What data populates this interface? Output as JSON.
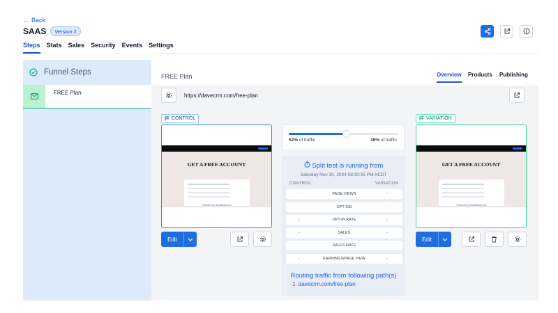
{
  "header": {
    "back_label": "Back",
    "title": "SAAS",
    "version": "Version 2",
    "tabs": [
      "Steps",
      "Stats",
      "Sales",
      "Security",
      "Events",
      "Settings"
    ],
    "icons": [
      "share-icon",
      "external-link-icon",
      "info-icon"
    ]
  },
  "sidebar": {
    "title": "Funnel Steps",
    "items": [
      {
        "label": "FREE Plan"
      }
    ]
  },
  "main": {
    "plan_name": "FREE Plan",
    "tabs": [
      "Overview",
      "Products",
      "Publishing"
    ],
    "url": "https://davecrm.com/free-plan"
  },
  "control": {
    "tag": "CONTROL",
    "preview_heading": "GET A FREE ACCOUNT",
    "preview_footer": "Powered by SmallBusiness",
    "edit_label": "Edit"
  },
  "variation": {
    "tag": "VARIATION",
    "preview_heading": "GET A FREE ACCOUNT",
    "preview_footer": "Powered by SmallBusiness",
    "edit_label": "Edit"
  },
  "split": {
    "control_pct": "52%",
    "variation_pct": "48%",
    "traffic_label": "of traffic",
    "control_fraction": 0.52,
    "title": "Split test is running from",
    "date": "Saturday Nov 30, 2024 08:30:05 PM ACDT",
    "col_control": "CONTROL",
    "col_variation": "VARIATION",
    "metrics": [
      {
        "name": "PAGE VIEWS",
        "control": "-",
        "variation": "-"
      },
      {
        "name": "OPT-INS",
        "control": "-",
        "variation": "-"
      },
      {
        "name": "OPT-IN RATE",
        "control": "-",
        "variation": "-"
      },
      {
        "name": "SALES",
        "control": "-",
        "variation": "-"
      },
      {
        "name": "SALES RATE",
        "control": "-",
        "variation": "-"
      },
      {
        "name": "EARNINGS/PAGE VIEW",
        "control": "-",
        "variation": "-"
      }
    ],
    "route_title": "Routing traffic from following path(s)",
    "route_item": "1. davecrm.com/free-plan"
  },
  "colors": {
    "accent": "#1d6fe0",
    "success": "#10b981",
    "sidebar_bg": "#ddeafa"
  }
}
